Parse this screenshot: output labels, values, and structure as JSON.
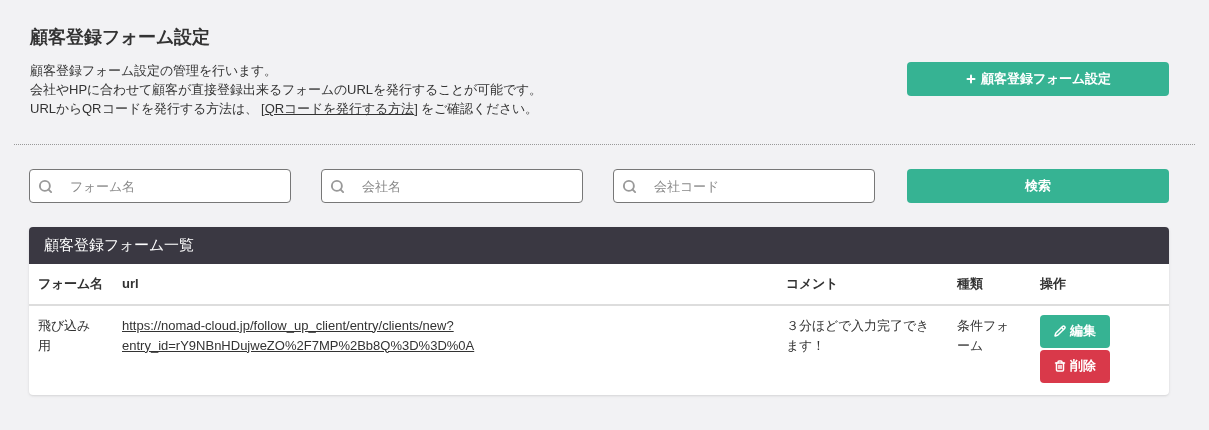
{
  "title": "顧客登録フォーム設定",
  "description": [
    "顧客登録フォーム設定の管理を行います。",
    "会社やHPに合わせて顧客が直接登録出来るフォームのURLを発行することが可能です。"
  ],
  "qr_line": {
    "before": "URLからQRコードを発行する方法は、 [",
    "link": "QRコードを発行する方法",
    "after": "] をご確認ください。"
  },
  "add_button": "顧客登録フォーム設定",
  "search": {
    "fields": [
      {
        "placeholder": "フォーム名"
      },
      {
        "placeholder": "会社名"
      },
      {
        "placeholder": "会社コード"
      }
    ],
    "button": "検索"
  },
  "table": {
    "title": "顧客登録フォーム一覧",
    "columns": [
      "フォーム名",
      "url",
      "コメント",
      "種類",
      "操作"
    ],
    "rows": [
      {
        "name": "飛び込み用",
        "url": "https://nomad-cloud.jp/follow_up_client/entry/clients/new?entry_id=rY9NBnHDujweZO%2F7MP%2Bb8Q%3D%3D%0A",
        "comment": "３分ほどで入力完了できます！",
        "type": "条件フォーム",
        "actions": [
          {
            "kind": "edit",
            "label": "編集"
          },
          {
            "kind": "delete",
            "label": "削除"
          }
        ]
      }
    ]
  }
}
